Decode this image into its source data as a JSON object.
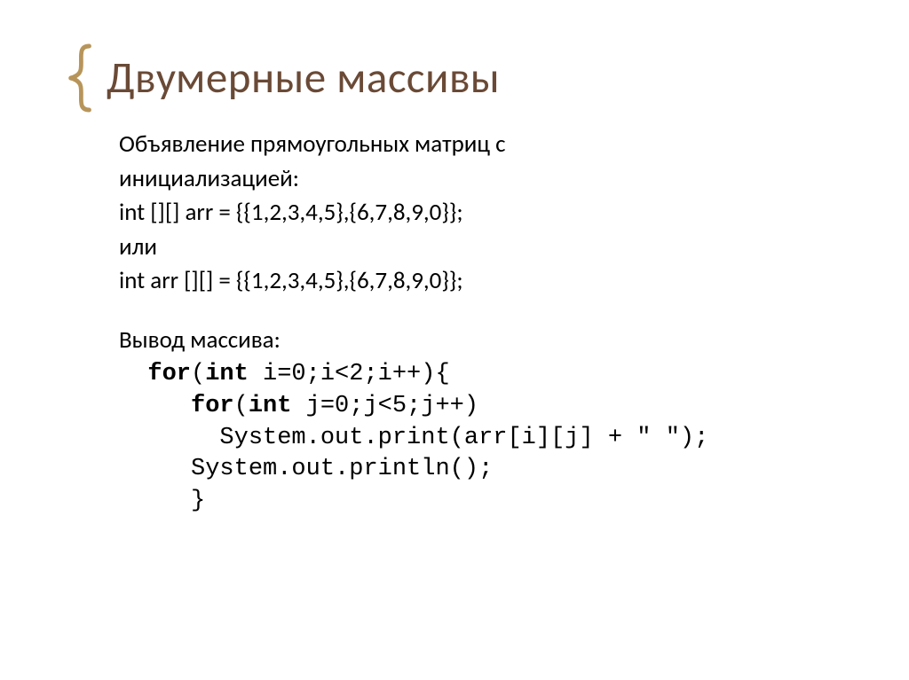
{
  "title": "Двумерные массивы",
  "intro1": "Объявление прямоугольных матриц с",
  "intro2": "инициализацией:",
  "decl1": "int [][] arr = {{1,2,3,4,5},{6,7,8,9,0}};",
  "or": "или",
  "decl2": "int arr [][] = {{1,2,3,4,5},{6,7,8,9,0}};",
  "out_label": "Вывод массива:",
  "code": {
    "l1a": "  ",
    "l1k": "for",
    "l1b": "(",
    "l1k2": "int",
    "l1c": " i=0;i<2;i++){",
    "l2a": "     ",
    "l2k": "for",
    "l2b": "(",
    "l2k2": "int",
    "l2c": " j=0;j<5;j++)",
    "l3": "       System.out.print(arr[i][j] + \" \");",
    "l4": "     System.out.println();",
    "l5": "     }"
  }
}
